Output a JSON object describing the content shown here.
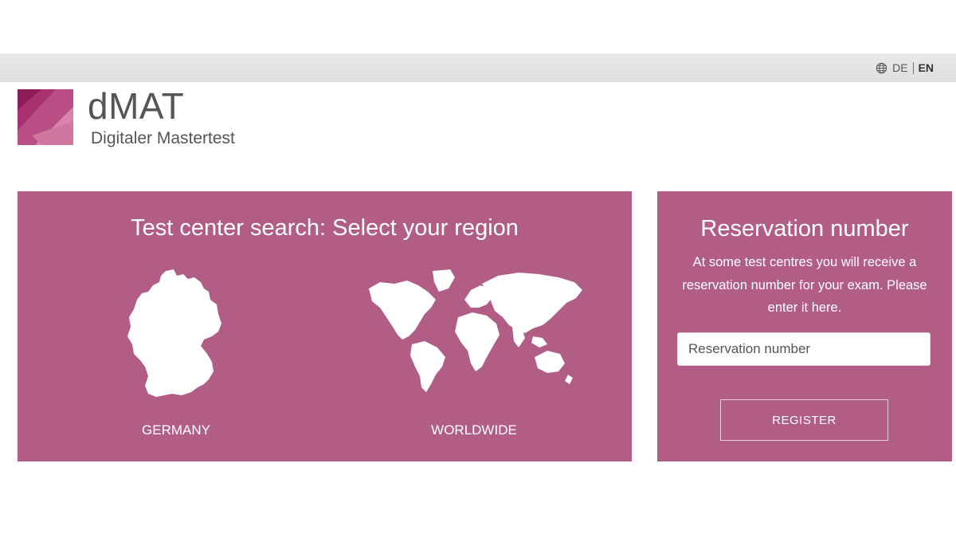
{
  "header": {
    "languages": [
      {
        "code": "DE",
        "active": false
      },
      {
        "code": "EN",
        "active": true
      }
    ],
    "globe_icon": "globe-icon"
  },
  "logo": {
    "title": "dMAT",
    "subtitle": "Digitaler Mastertest"
  },
  "region_panel": {
    "title": "Test center search: Select your region",
    "options": [
      {
        "label": "GERMANY",
        "icon": "germany-map-icon"
      },
      {
        "label": "WORLDWIDE",
        "icon": "world-map-icon"
      }
    ]
  },
  "reservation_panel": {
    "title": "Reservation number",
    "description": "At some test centres you will receive a reservation number for your exam. Please enter it here.",
    "input_placeholder": "Reservation number",
    "input_value": "",
    "register_label": "REGISTER"
  },
  "colors": {
    "panel_background": "#b15d86",
    "topbar": "#e4e4e4",
    "logo_dark": "#9c1f63",
    "logo_light": "#c96b98"
  }
}
